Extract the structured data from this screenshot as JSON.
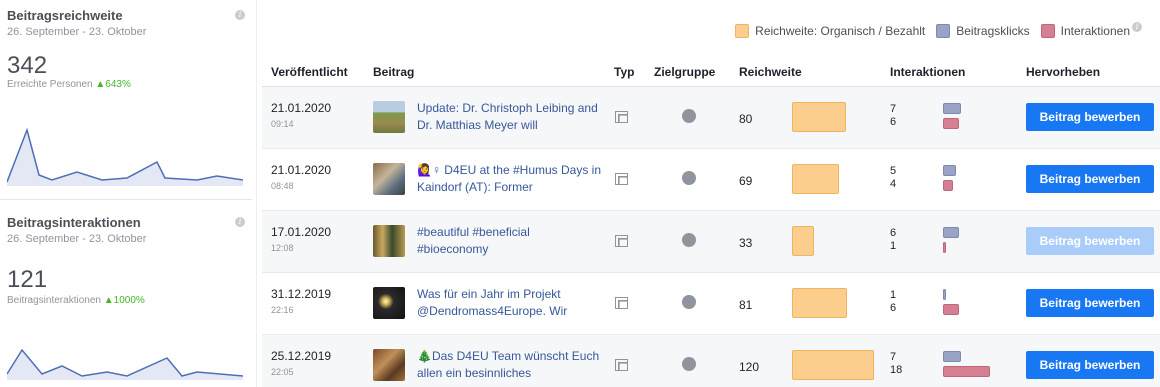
{
  "colors": {
    "reach": "#fcce8e",
    "clicks": "#9aa3c5",
    "interactions": "#d57f93",
    "boost": "#1877f2",
    "boost_disabled": "#a9cdf8"
  },
  "reach_card": {
    "title": "Beitragsreichweite",
    "range": "26. September - 23. Oktober",
    "value": "342",
    "subtitle": "Erreichte Personen",
    "delta": "▲643%",
    "info_icon": "info-icon"
  },
  "interaction_card": {
    "title": "Beitragsinteraktionen",
    "range": "26. September - 23. Oktober",
    "value": "121",
    "subtitle": "Beitragsinteraktionen",
    "delta": "▲1000%",
    "info_icon": "info-icon"
  },
  "legend": {
    "reach": "Reichweite: Organisch / Bezahlt",
    "clicks": "Beitragsklicks",
    "interactions": "Interaktionen"
  },
  "table": {
    "headers": {
      "published": "Veröffentlicht",
      "post": "Beitrag",
      "type": "Typ",
      "audience": "Zielgruppe",
      "reach": "Reichweite",
      "interactions": "Interaktionen",
      "boost": "Hervorheben"
    },
    "rows": [
      {
        "date": "21.01.2020",
        "time": "09:14",
        "text": "Update: Dr. Christoph Leibing and Dr. Matthias Meyer will",
        "reach": 80,
        "clicks": 7,
        "inter": 6,
        "boost": "Beitrag bewerben",
        "boost_enabled": true
      },
      {
        "date": "21.01.2020",
        "time": "08:48",
        "text": "🙋‍♀️♀ D4EU at the #Humus Days in Kaindorf (AT): Former",
        "reach": 69,
        "clicks": 5,
        "inter": 4,
        "boost": "Beitrag bewerben",
        "boost_enabled": true
      },
      {
        "date": "17.01.2020",
        "time": "12:08",
        "text": "#beautiful #beneficial #bioeconomy",
        "reach": 33,
        "clicks": 6,
        "inter": 1,
        "boost": "Beitrag bewerben",
        "boost_enabled": false
      },
      {
        "date": "31.12.2019",
        "time": "22:16",
        "text": "Was für ein Jahr im Projekt @Dendromass4Europe. Wir",
        "reach": 81,
        "clicks": 1,
        "inter": 6,
        "boost": "Beitrag bewerben",
        "boost_enabled": true
      },
      {
        "date": "25.12.2019",
        "time": "22:05",
        "text": "🎄Das D4EU Team wünscht Euch allen ein besinnliches",
        "reach": 120,
        "clicks": 7,
        "inter": 18,
        "boost": "Beitrag bewerben",
        "boost_enabled": true
      }
    ]
  }
}
